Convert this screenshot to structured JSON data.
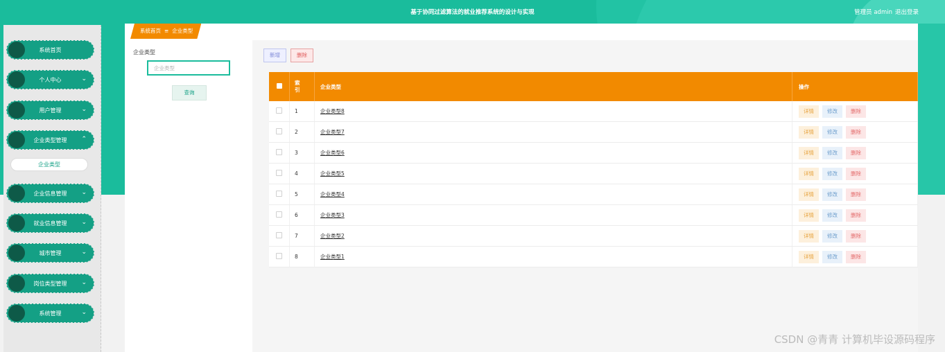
{
  "header": {
    "title": "基于协同过滤算法的就业推荐系统的设计与实现",
    "user_label": "管理员 admin",
    "logout_label": "退出登录"
  },
  "sidebar": {
    "items": [
      {
        "label": "系统首页",
        "has_chevron": false,
        "chevron": ""
      },
      {
        "label": "个人中心",
        "has_chevron": true,
        "chevron": "⌄"
      },
      {
        "label": "用户管理",
        "has_chevron": true,
        "chevron": "⌄"
      },
      {
        "label": "企业类型管理",
        "has_chevron": true,
        "chevron": "⌃"
      },
      {
        "label": "企业信息管理",
        "has_chevron": true,
        "chevron": "⌄"
      },
      {
        "label": "就业信息管理",
        "has_chevron": true,
        "chevron": "⌄"
      },
      {
        "label": "城市管理",
        "has_chevron": true,
        "chevron": "⌄"
      },
      {
        "label": "岗位类型管理",
        "has_chevron": true,
        "chevron": "⌄"
      },
      {
        "label": "系统管理",
        "has_chevron": true,
        "chevron": "⌄"
      }
    ],
    "submenu_label": "企业类型"
  },
  "breadcrumb": {
    "home": "系统首页",
    "separator": "≡",
    "current": "企业类型"
  },
  "search": {
    "field_label": "企业类型",
    "placeholder": "企业类型",
    "button_label": "查询"
  },
  "toolbar": {
    "add_label": "新增",
    "delete_label": "删除"
  },
  "table": {
    "columns": {
      "index": "索引",
      "name": "企业类型",
      "ops": "操作"
    },
    "rows": [
      {
        "index": "1",
        "name": "企业类型8"
      },
      {
        "index": "2",
        "name": "企业类型7"
      },
      {
        "index": "3",
        "name": "企业类型6"
      },
      {
        "index": "4",
        "name": "企业类型5"
      },
      {
        "index": "5",
        "name": "企业类型4"
      },
      {
        "index": "6",
        "name": "企业类型3"
      },
      {
        "index": "7",
        "name": "企业类型2"
      },
      {
        "index": "8",
        "name": "企业类型1"
      }
    ],
    "row_actions": {
      "detail": "详情",
      "edit": "修改",
      "delete": "删除"
    }
  },
  "watermark": "CSDN @青青  计算机毕设源码程序",
  "colors": {
    "primary": "#1abc9c",
    "accent": "#f28a00",
    "danger": "#e05b5b"
  }
}
